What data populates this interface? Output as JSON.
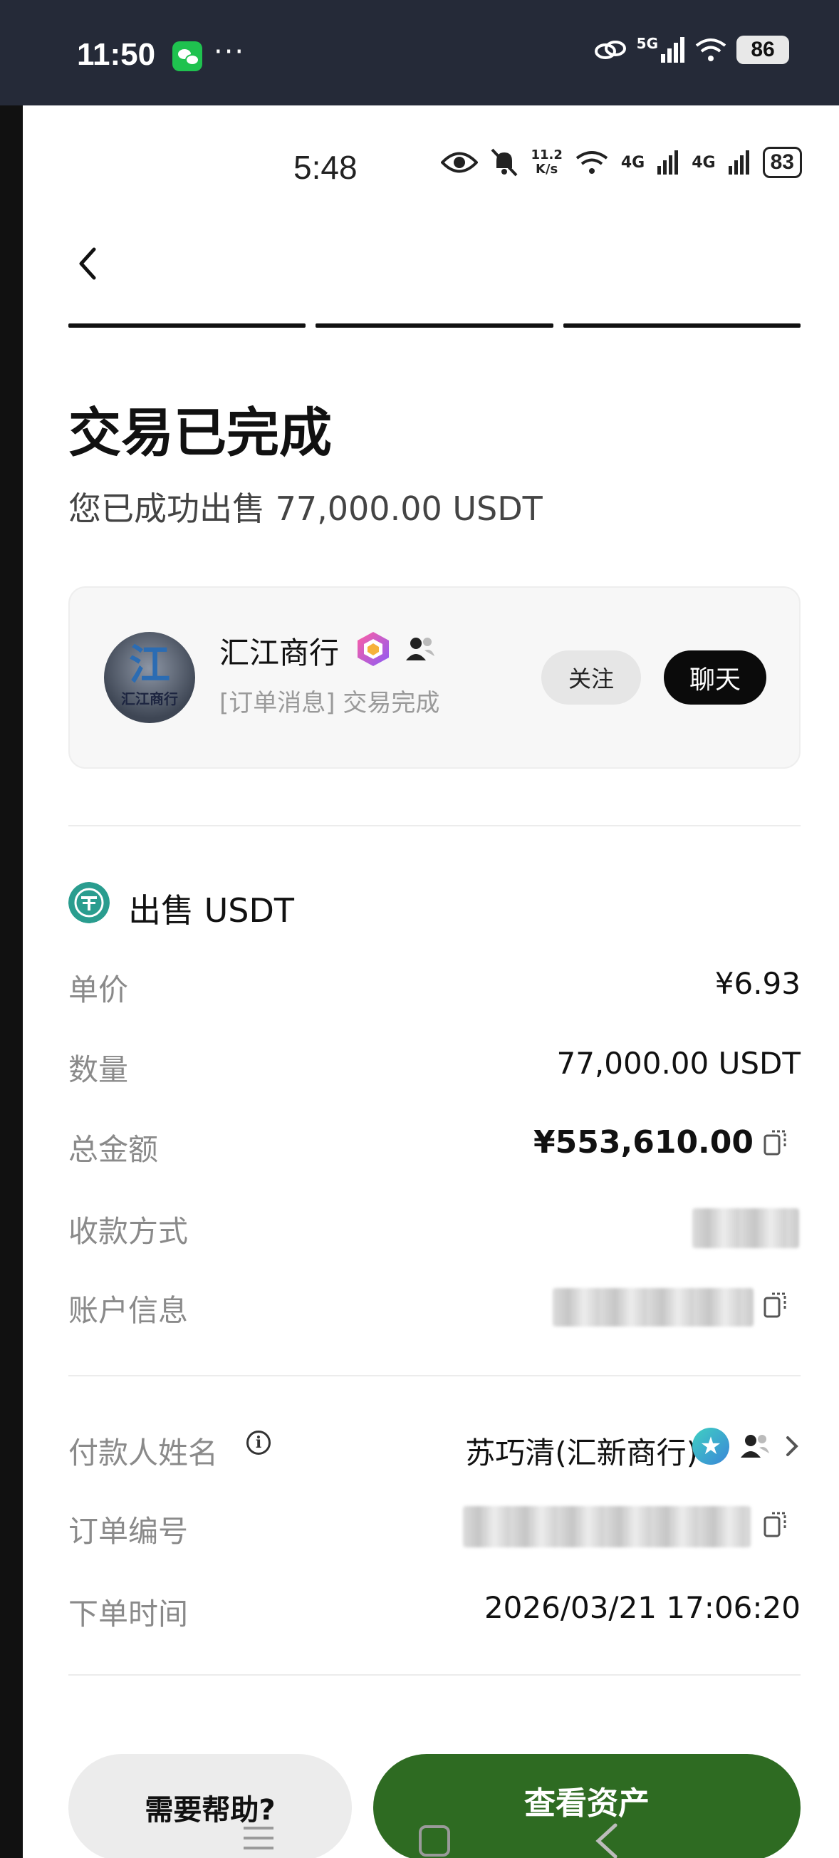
{
  "outer_status": {
    "time": "11:50",
    "dots": "···",
    "network": "5G",
    "battery": "86"
  },
  "inner_status": {
    "time": "5:48",
    "speed_top": "11.2",
    "speed_bottom": "K/s",
    "sig1": "4G",
    "sig2": "4G",
    "battery": "83"
  },
  "page": {
    "title": "交易已完成",
    "subtitle": "您已成功出售 77,000.00 USDT"
  },
  "merchant": {
    "name": "汇江商行",
    "avatar_text": "汇江商行",
    "avatar_mark": "江",
    "message": "[订单消息] 交易完成",
    "follow_label": "关注",
    "chat_label": "聊天"
  },
  "order": {
    "heading": "出售 USDT",
    "unit_price_label": "单价",
    "unit_price": "¥6.93",
    "quantity_label": "数量",
    "quantity": "77,000.00 USDT",
    "total_label": "总金额",
    "total": "¥553,610.00",
    "payment_method_label": "收款方式",
    "account_label": "账户信息",
    "payer_label": "付款人姓名",
    "payer_name": "苏巧清(汇新商行)",
    "order_no_label": "订单编号",
    "order_time_label": "下单时间",
    "order_time": "2026/03/21 17:06:20"
  },
  "actions": {
    "help_label": "需要帮助?",
    "assets_label": "查看资产"
  },
  "colors": {
    "outer_bar": "#252a38",
    "primary_green": "#2e6b22",
    "usdt_teal": "#2a9d8f"
  }
}
